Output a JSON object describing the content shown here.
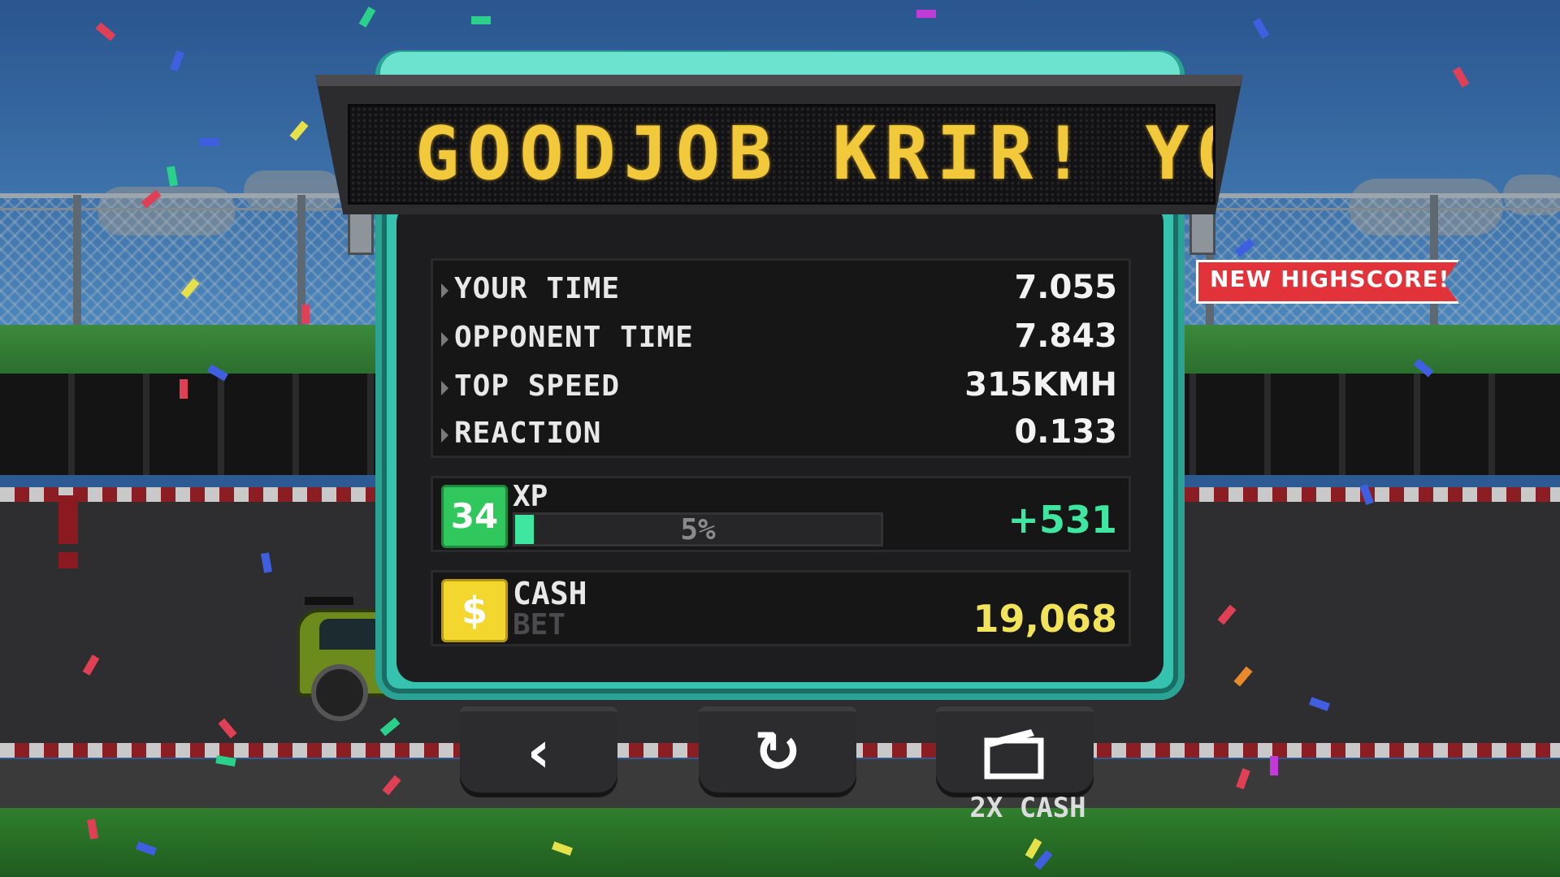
{
  "marquee": {
    "text": "GOODJOB KRIR! YO"
  },
  "stats": [
    {
      "label": "YOUR TIME",
      "value": "7.055"
    },
    {
      "label": "OPPONENT TIME",
      "value": "7.843"
    },
    {
      "label": "TOP SPEED",
      "value": "315KMH"
    },
    {
      "label": "REACTION",
      "value": "0.133"
    }
  ],
  "xp": {
    "level": "34",
    "label": "XP",
    "progress_percent": 5,
    "progress_text": "5%",
    "gain": "+531"
  },
  "cash": {
    "icon_glyph": "$",
    "label": "CASH",
    "bet_label": "BET",
    "amount": "19,068"
  },
  "banner": {
    "text": "NEW HIGHSCORE!"
  },
  "buttons": {
    "back": {
      "icon": "chevron-left-icon",
      "glyph": "‹"
    },
    "restart": {
      "icon": "restart-icon",
      "glyph": "↻"
    },
    "double_cash": {
      "icon": "video-camera-icon",
      "caption": "2X CASH"
    }
  },
  "colors": {
    "panel": "#35c3b0",
    "led_text": "#f1c93a",
    "xp_gain": "#3ee6a0",
    "cash_amount": "#f3e35a",
    "banner": "#e3333a"
  }
}
